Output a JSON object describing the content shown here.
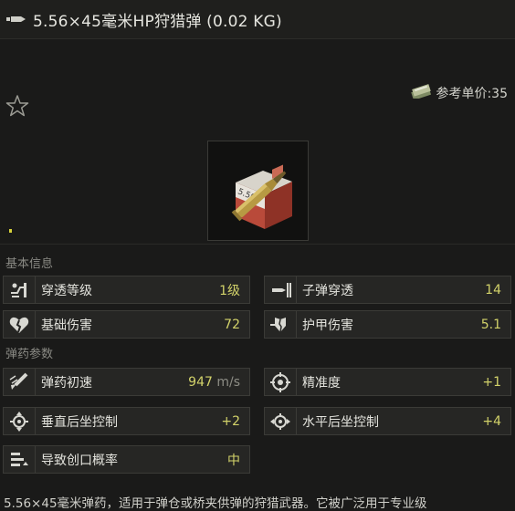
{
  "window": {
    "title": "5.56×45毫米HP狩猎弹 (0.02 KG)",
    "price_label": "参考单价:35"
  },
  "sections": {
    "basic": "基本信息",
    "ammo": "弹药参数"
  },
  "stats": {
    "penetration_level": {
      "label": "穿透等级",
      "value": "1级",
      "icon": "penetration-icon"
    },
    "bullet_penetration": {
      "label": "子弹穿透",
      "value": "14",
      "icon": "bullet-penetration-icon"
    },
    "base_damage": {
      "label": "基础伤害",
      "value": "72",
      "icon": "broken-heart-icon"
    },
    "armor_damage": {
      "label": "护甲伤害",
      "value": "5.1",
      "icon": "armor-damage-icon"
    },
    "muzzle_velocity": {
      "label": "弹药初速",
      "value": "947",
      "unit": "m/s",
      "icon": "velocity-icon"
    },
    "accuracy": {
      "label": "精准度",
      "value": "+1",
      "icon": "crosshair-icon"
    },
    "vertical_recoil": {
      "label": "垂直后坐控制",
      "value": "+2",
      "icon": "vertical-recoil-icon"
    },
    "horizontal_recoil": {
      "label": "水平后坐控制",
      "value": "+4",
      "icon": "horizontal-recoil-icon"
    },
    "bleed_chance": {
      "label": "导致创口概率",
      "value": "中",
      "icon": "bleed-icon"
    }
  },
  "description": "5.56×45毫米弹药，适用于弹仓或桥夹供弹的狩猎武器。它被广泛用于专业级",
  "colors": {
    "value": "#d3d36a",
    "background": "#1a1a19",
    "panel": "#262624"
  }
}
